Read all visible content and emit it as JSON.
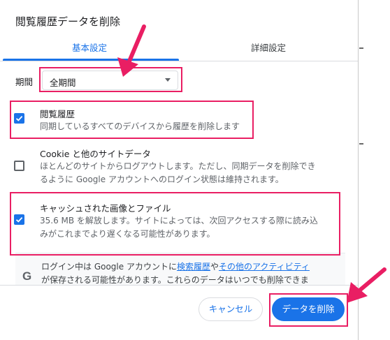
{
  "dialog": {
    "title": "閲覧履歴データを削除",
    "tabs": [
      {
        "label": "基本設定",
        "active": true
      },
      {
        "label": "詳細設定",
        "active": false
      }
    ],
    "period": {
      "label": "期間",
      "selected": "全期間"
    },
    "items": [
      {
        "title": "閲覧履歴",
        "desc": [
          "同期しているすべてのデバイスから履歴を削除します"
        ],
        "checked": true
      },
      {
        "title": "Cookie と他のサイトデータ",
        "desc": [
          "ほとんどのサイトからログアウトします。ただし、同期データを削除でき",
          "るように Google アカウントへのログイン状態は維持されます。"
        ],
        "checked": false
      },
      {
        "title": "キャッシュされた画像とファイル",
        "desc": [
          "35.6 MB を解放します。サイトによっては、次回アクセスする際に読み込",
          "みがこれまでより遅くなる可能性があります。"
        ],
        "checked": true
      }
    ],
    "info": {
      "icon": "google-g-icon",
      "line1_before": "ログイン中は Google アカウントに",
      "link1": "検索履歴",
      "between": "や",
      "link2": "その他のアクティビティ",
      "line2": "が保存される可能性があります。これらのデータはいつでも削除できま"
    },
    "buttons": {
      "cancel": "キャンセル",
      "clear": "データを削除"
    }
  },
  "colors": {
    "accent": "#1a73e8",
    "annotation": "#e91e63",
    "text": "#202124",
    "secondary_text": "#5f6368"
  }
}
